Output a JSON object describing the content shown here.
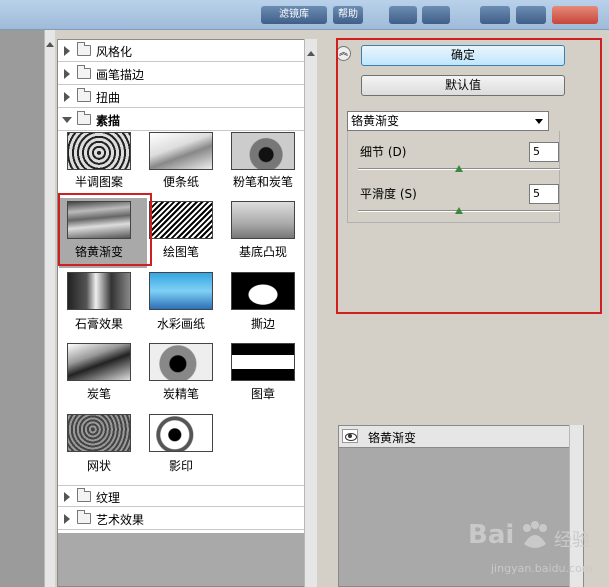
{
  "window": {
    "tab1": "滤镜库",
    "tab2": "帮助"
  },
  "gallery": {
    "categories_top": [
      {
        "label": "风格化",
        "expanded": false
      },
      {
        "label": "画笔描边",
        "expanded": false
      },
      {
        "label": "扭曲",
        "expanded": false
      },
      {
        "label": "素描",
        "expanded": true
      }
    ],
    "filters": [
      "半调图案",
      "便条纸",
      "粉笔和炭笔",
      "铬黄渐变",
      "绘图笔",
      "基底凸现",
      "石膏效果",
      "水彩画纸",
      "撕边",
      "炭笔",
      "炭精笔",
      "图章",
      "网状",
      "影印"
    ],
    "selected_filter": "铬黄渐变",
    "categories_bottom": [
      {
        "label": "纹理",
        "expanded": false
      },
      {
        "label": "艺术效果",
        "expanded": false
      }
    ]
  },
  "settings": {
    "ok_label": "确定",
    "default_label": "默认值",
    "filter_select": "铬黄渐变",
    "params": [
      {
        "label": "细节 (D)",
        "value": "5",
        "slider": 0.5
      },
      {
        "label": "平滑度 (S)",
        "value": "5",
        "slider": 0.5
      }
    ]
  },
  "layers": {
    "items": [
      {
        "name": "铬黄渐变",
        "visible": true
      }
    ]
  },
  "watermark": {
    "brand": "Bai",
    "brand2": "经验",
    "url": "jingyan.baidu.com"
  },
  "colors": {
    "highlight_frame": "#d11f1f",
    "accent": "#3c7fb1"
  }
}
